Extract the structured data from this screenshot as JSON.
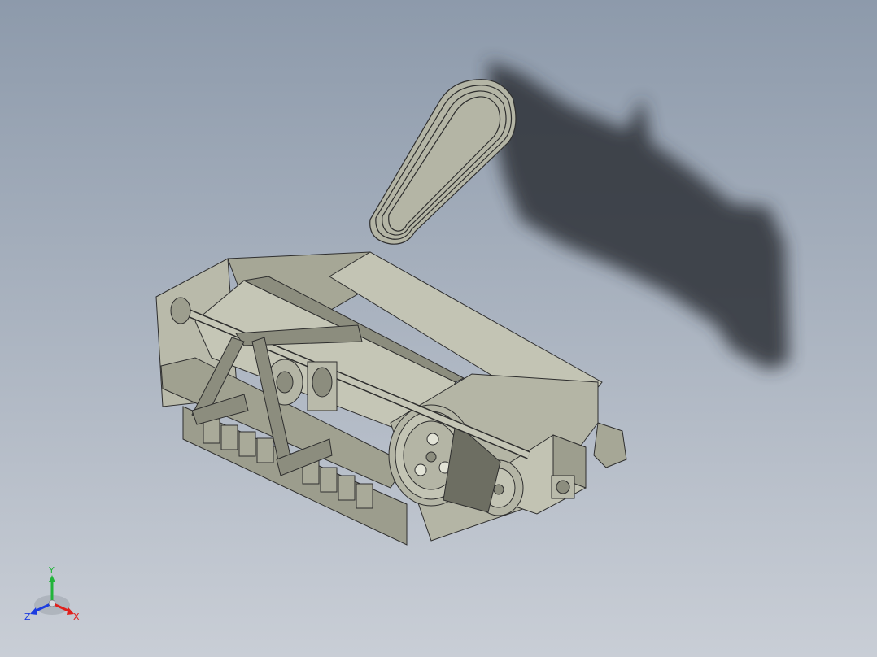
{
  "viewport": {
    "background_top": "#8d9aab",
    "background_bottom": "#c9ced6"
  },
  "model": {
    "part_color": "#b4b5a5",
    "part_dark": "#8c8d7e",
    "edge_color": "#2e2e2e",
    "shadow_color": "#2e3338"
  },
  "triad": {
    "x_label": "X",
    "y_label": "Y",
    "z_label": "Z",
    "x_color": "#e0201c",
    "y_color": "#22b43a",
    "z_color": "#1c3ce0"
  }
}
